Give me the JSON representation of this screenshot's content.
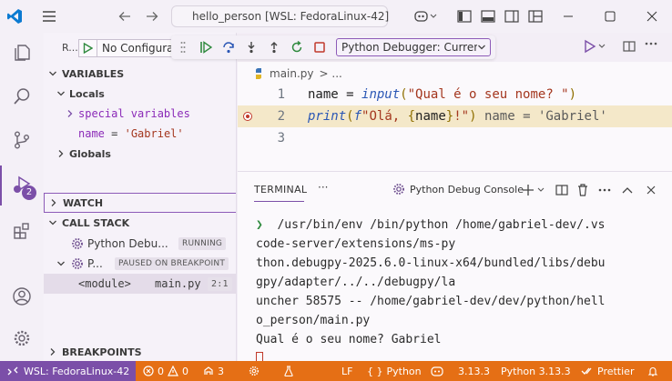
{
  "titlebar": {
    "search_text": "hello_person [WSL: FedoraLinux-42]"
  },
  "run_view": {
    "label": "R...",
    "config_select": "No Configurations"
  },
  "variables": {
    "header": "VARIABLES",
    "locals_label": "Locals",
    "special_label": "special variables",
    "name_key": "name",
    "name_eq": " = ",
    "name_value": "'Gabriel'",
    "globals_label": "Globals"
  },
  "watch": {
    "header": "WATCH"
  },
  "call_stack": {
    "header": "CALL STACK",
    "thread1_name": "Python Debu...",
    "thread1_state": "RUNNING",
    "thread2_name": "P...",
    "thread2_state": "PAUSED ON BREAKPOINT",
    "frame_name": "<module>",
    "frame_file": "main.py",
    "frame_pos": "2:1"
  },
  "breakpoints": {
    "header": "BREAKPOINTS"
  },
  "debug_toolbar": {
    "config_label": "Python Debugger: Current File"
  },
  "editor": {
    "breadcrumb_file": "main.py",
    "breadcrumb_sep": "> ...",
    "lines": [
      {
        "number": "1"
      },
      {
        "number": "2",
        "inline_value": "name = 'Gabriel'"
      },
      {
        "number": "3"
      }
    ]
  },
  "panel": {
    "tab_terminal": "TERMINAL",
    "more": "···",
    "terminal_title": "Python Debug Console",
    "lines": [
      "/usr/bin/env /bin/python /home/gabriel-dev/.vs",
      "code-server/extensions/ms-py",
      "thon.debugpy-2025.6.0-linux-x64/bundled/libs/debu",
      "gpy/adapter/../../debugpy/la",
      "uncher 58575 -- /home/gabriel-dev/dev/python/hell",
      "o_person/main.py",
      "Qual é o seu nome? Gabriel"
    ]
  },
  "statusbar": {
    "remote": "WSL: FedoraLinux-42",
    "errors": "0",
    "warnings": "0",
    "ports": "3",
    "eol": "LF",
    "language": "Python",
    "python_version": "3.13.3",
    "interpreter": "Python 3.13.3",
    "formatter": "Prettier"
  },
  "colors": {
    "accent": "#7b4fa8",
    "debug_status": "#e56f15",
    "current_line": "#f4e8c9"
  }
}
